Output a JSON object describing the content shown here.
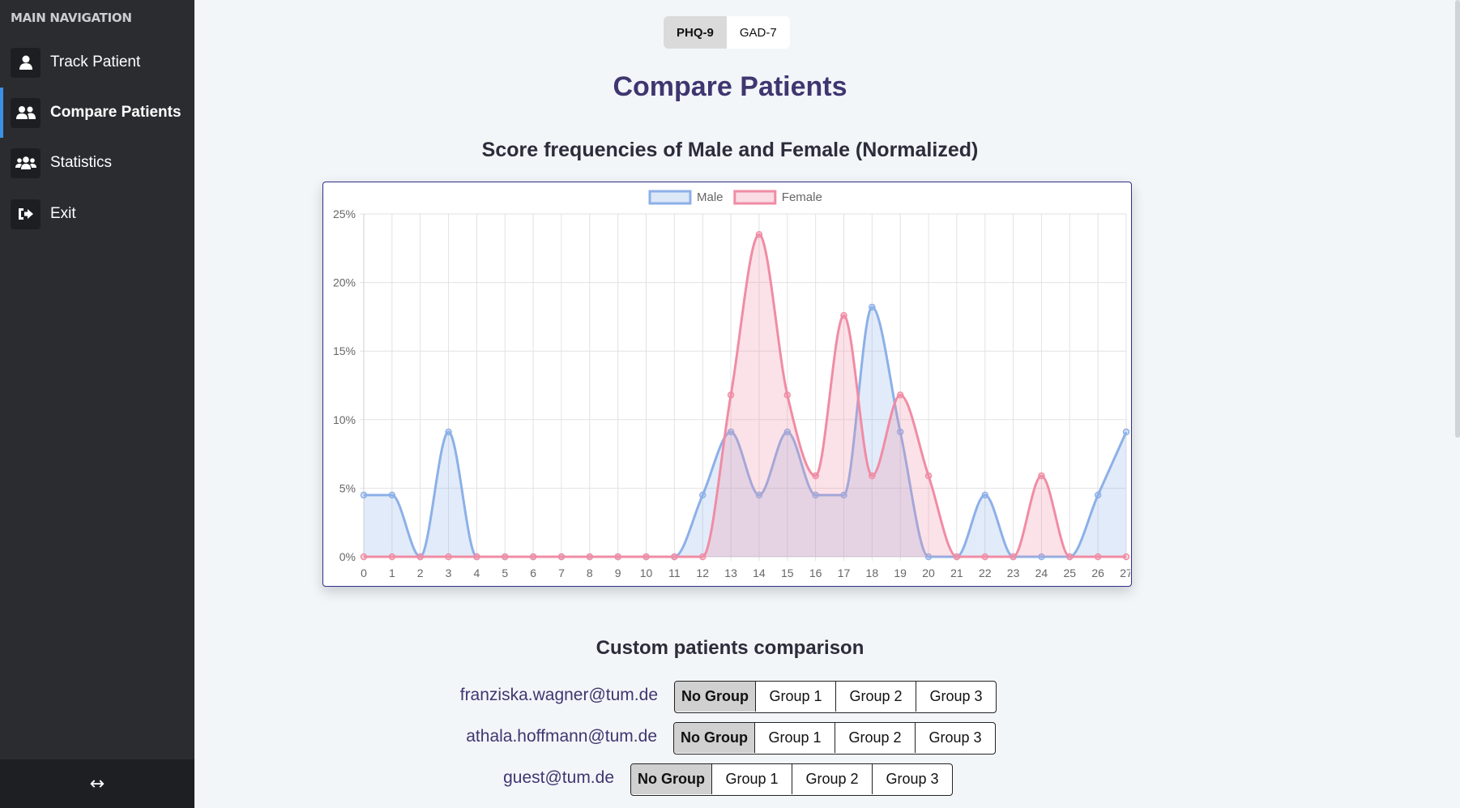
{
  "sidebar": {
    "heading": "MAIN NAVIGATION",
    "items": [
      {
        "label": "Track Patient",
        "icon": "user-icon",
        "active": false
      },
      {
        "label": "Compare Patients",
        "icon": "user-friends-icon",
        "active": true
      },
      {
        "label": "Statistics",
        "icon": "users-icon",
        "active": false
      },
      {
        "label": "Exit",
        "icon": "sign-out-icon",
        "active": false
      }
    ],
    "footer_icon": "resize-horizontal-icon",
    "footer_glyph": "↔"
  },
  "scale_toggle": {
    "options": [
      "PHQ-9",
      "GAD-7"
    ],
    "selected": "PHQ-9"
  },
  "page_title": "Compare Patients",
  "chart_title": "Score frequencies of Male and Female (Normalized)",
  "chart_data": {
    "type": "line",
    "title": "Score frequencies of Male and Female (Normalized)",
    "x": [
      0,
      1,
      2,
      3,
      4,
      5,
      6,
      7,
      8,
      9,
      10,
      11,
      12,
      13,
      14,
      15,
      16,
      17,
      18,
      19,
      20,
      21,
      22,
      23,
      24,
      25,
      26,
      27
    ],
    "ylim": [
      0,
      25
    ],
    "y_ticks": [
      "0%",
      "5%",
      "10%",
      "15%",
      "20%",
      "25%"
    ],
    "grid": true,
    "legend_position": "top",
    "fill": true,
    "series": [
      {
        "name": "Male",
        "color": "#8cb0e8",
        "values": [
          4.5,
          4.5,
          0,
          9.1,
          0,
          0,
          0,
          0,
          0,
          0,
          0,
          0,
          4.5,
          9.1,
          4.5,
          9.1,
          4.5,
          4.5,
          18.2,
          9.1,
          0,
          0,
          4.5,
          0,
          0,
          0,
          4.5,
          9.1
        ]
      },
      {
        "name": "Female",
        "color": "#f08ca4",
        "values": [
          0,
          0,
          0,
          0,
          0,
          0,
          0,
          0,
          0,
          0,
          0,
          0,
          0,
          11.8,
          23.5,
          11.8,
          5.9,
          17.6,
          5.9,
          11.8,
          5.9,
          0,
          0,
          0,
          5.9,
          0,
          0,
          0
        ]
      }
    ]
  },
  "comparison": {
    "title": "Custom patients comparison",
    "group_options": [
      "No Group",
      "Group 1",
      "Group 2",
      "Group 3"
    ],
    "patients": [
      {
        "email": "franziska.wagner@tum.de",
        "selected": "No Group"
      },
      {
        "email": "athala.hoffmann@tum.de",
        "selected": "No Group"
      },
      {
        "email": "guest@tum.de",
        "selected": "No Group"
      }
    ]
  }
}
